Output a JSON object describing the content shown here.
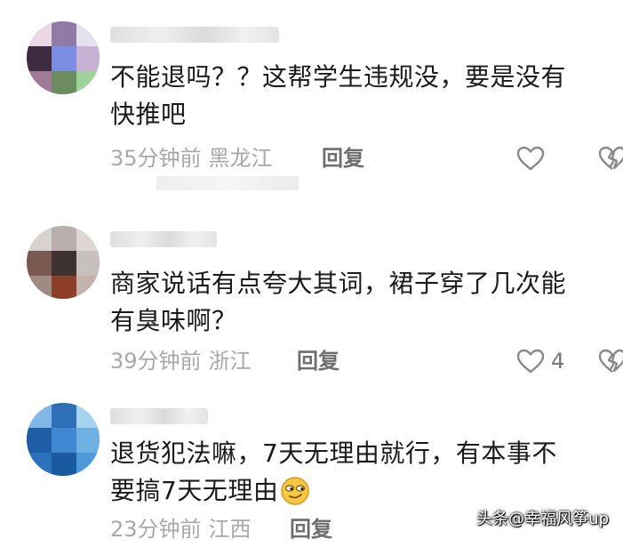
{
  "comments": [
    {
      "text_line1": "不能退吗？？这帮学生违规没，要是没有",
      "text_line2": "快推吧",
      "time": "35分钟前",
      "location": "黑龙江",
      "reply_label": "回复",
      "like_count": ""
    },
    {
      "text_line1": "商家说话有点夸大其词，裙子穿了几次能",
      "text_line2": "有臭味啊？",
      "time": "39分钟前",
      "location": "浙江",
      "reply_label": "回复",
      "like_count": "4"
    },
    {
      "text_line1": "退货犯法嘛，7天无理由就行，有本事不",
      "text_line2": "要搞7天无理由",
      "time": "23分钟前",
      "location": "江西",
      "reply_label": "回复",
      "like_count": ""
    }
  ],
  "watermark": "头条@幸福风筝up",
  "icons": {
    "like": "heart-outline-icon",
    "dislike": "broken-heart-icon",
    "emoji": "smirk-face-emoji"
  },
  "colors": {
    "text": "#1a1a1a",
    "meta": "#a8a8a8",
    "reply": "#6e6e6e"
  }
}
